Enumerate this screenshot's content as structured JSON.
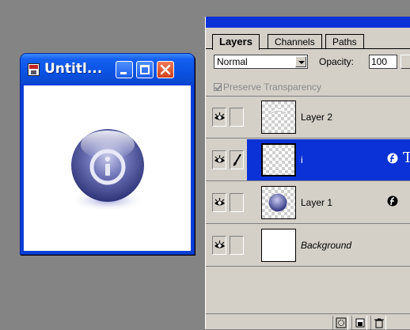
{
  "document_window": {
    "title": "Untitl...",
    "buttons": [
      "minimize",
      "maximize",
      "close"
    ],
    "icon": "photoshop-doc-icon",
    "content_icon": "info-icon"
  },
  "layers_palette": {
    "tabs": [
      "Layers",
      "Channels",
      "Paths"
    ],
    "active_tab": "Layers",
    "blend_mode": "Normal",
    "opacity_label": "Opacity:",
    "opacity_value": "100",
    "preserve_transparency_label": "Preserve Transparency",
    "preserve_transparency_checked": true,
    "layers": [
      {
        "name": "Layer 2",
        "visible": true,
        "selected": false,
        "effects": false
      },
      {
        "name": "i",
        "visible": true,
        "selected": true,
        "effects": true,
        "type_layer": true
      },
      {
        "name": "Layer 1",
        "visible": true,
        "selected": false,
        "effects": true
      },
      {
        "name": "Background",
        "visible": true,
        "selected": false,
        "effects": false,
        "italic": true
      }
    ],
    "bottom_buttons": [
      "new-layer-icon",
      "trash-icon"
    ]
  },
  "colors": {
    "desktop": "#848484",
    "xp_title": "#0b54e5",
    "palette_bg": "#d4d0c8",
    "selection": "#0a32d6"
  }
}
